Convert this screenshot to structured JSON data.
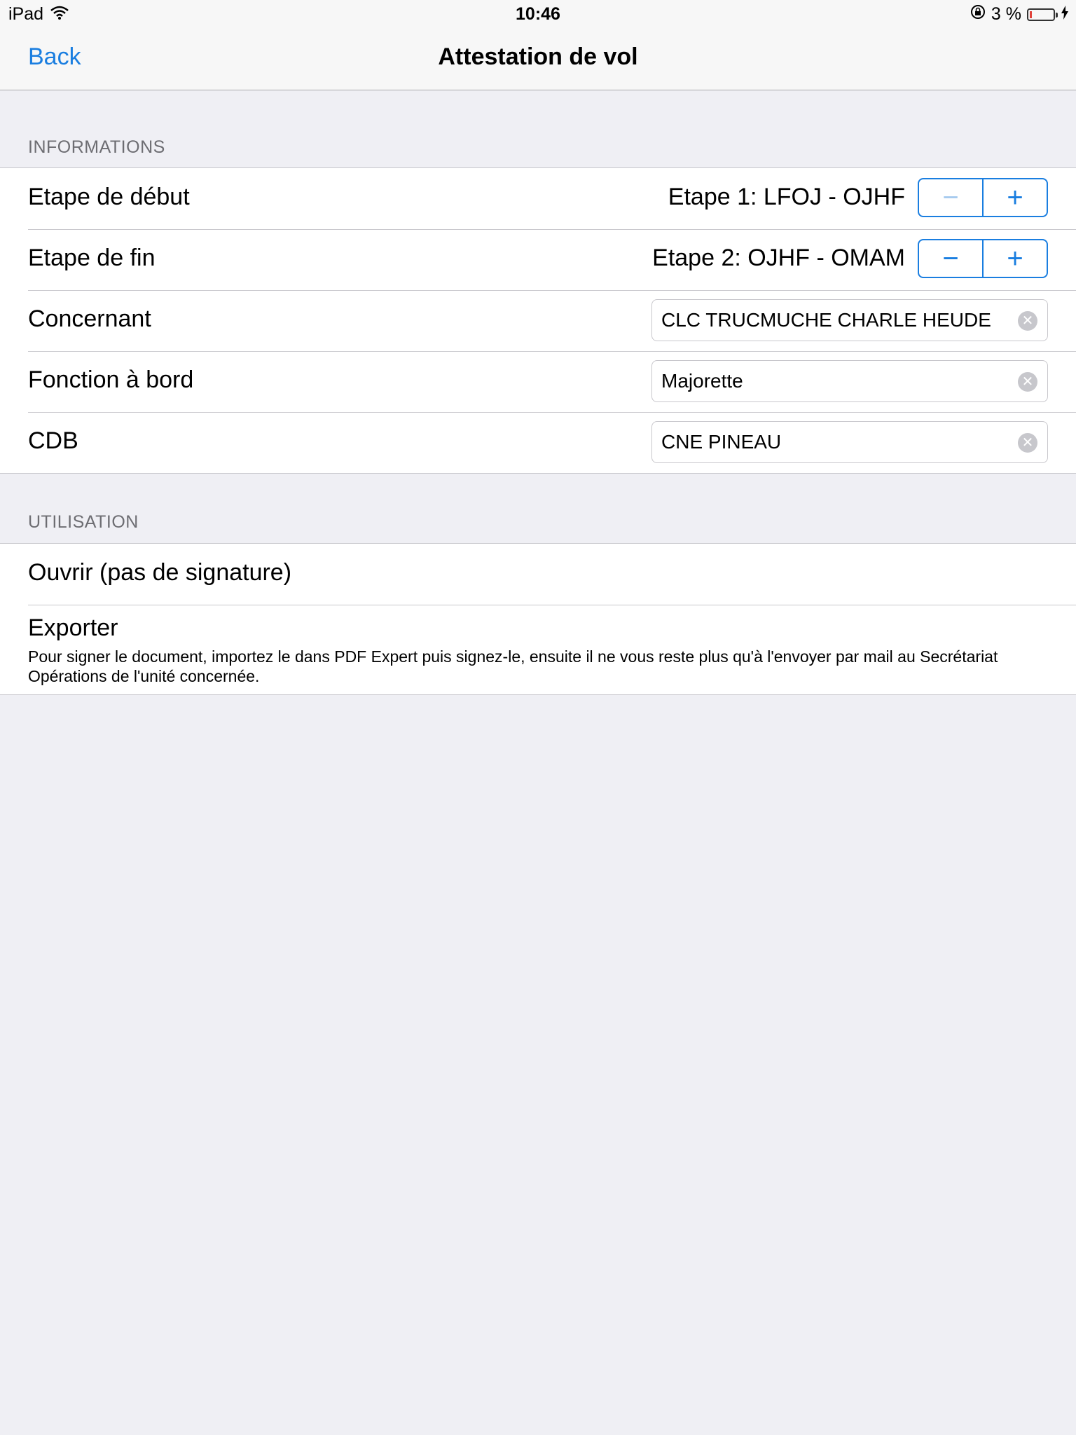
{
  "status": {
    "device": "iPad",
    "time": "10:46",
    "battery": "3 %",
    "battery_level": 0.03
  },
  "nav": {
    "back_label": "Back",
    "title": "Attestation de vol"
  },
  "informations": {
    "header": "INFORMATIONS",
    "etape_debut": {
      "label": "Etape de début",
      "value": "Etape 1: LFOJ - OJHF",
      "minus": "−",
      "plus": "+"
    },
    "etape_fin": {
      "label": "Etape de fin",
      "value": "Etape 2: OJHF - OMAM",
      "minus": "−",
      "plus": "+"
    },
    "concernant": {
      "label": "Concernant",
      "value": "CLC TRUCMUCHE CHARLE HEUDE"
    },
    "fonction": {
      "label": "Fonction à bord",
      "value": "Majorette"
    },
    "cdb": {
      "label": "CDB",
      "value": "CNE PINEAU"
    }
  },
  "utilisation": {
    "header": "UTILISATION",
    "ouvrir_label": "Ouvrir (pas de signature)",
    "exporter_label": "Exporter",
    "exporter_desc": "Pour signer le document, importez le dans PDF Expert puis signez-le, ensuite il ne vous reste plus qu'à l'envoyer par mail au Secrétariat Opérations de l'unité concernée."
  },
  "colors": {
    "accent": "#1a7ee0",
    "background": "#efeff4",
    "separator": "#c8c7cc"
  },
  "icons": [
    "wifi-icon",
    "rotation-lock-icon",
    "battery-icon",
    "charging-icon",
    "clear-icon"
  ]
}
